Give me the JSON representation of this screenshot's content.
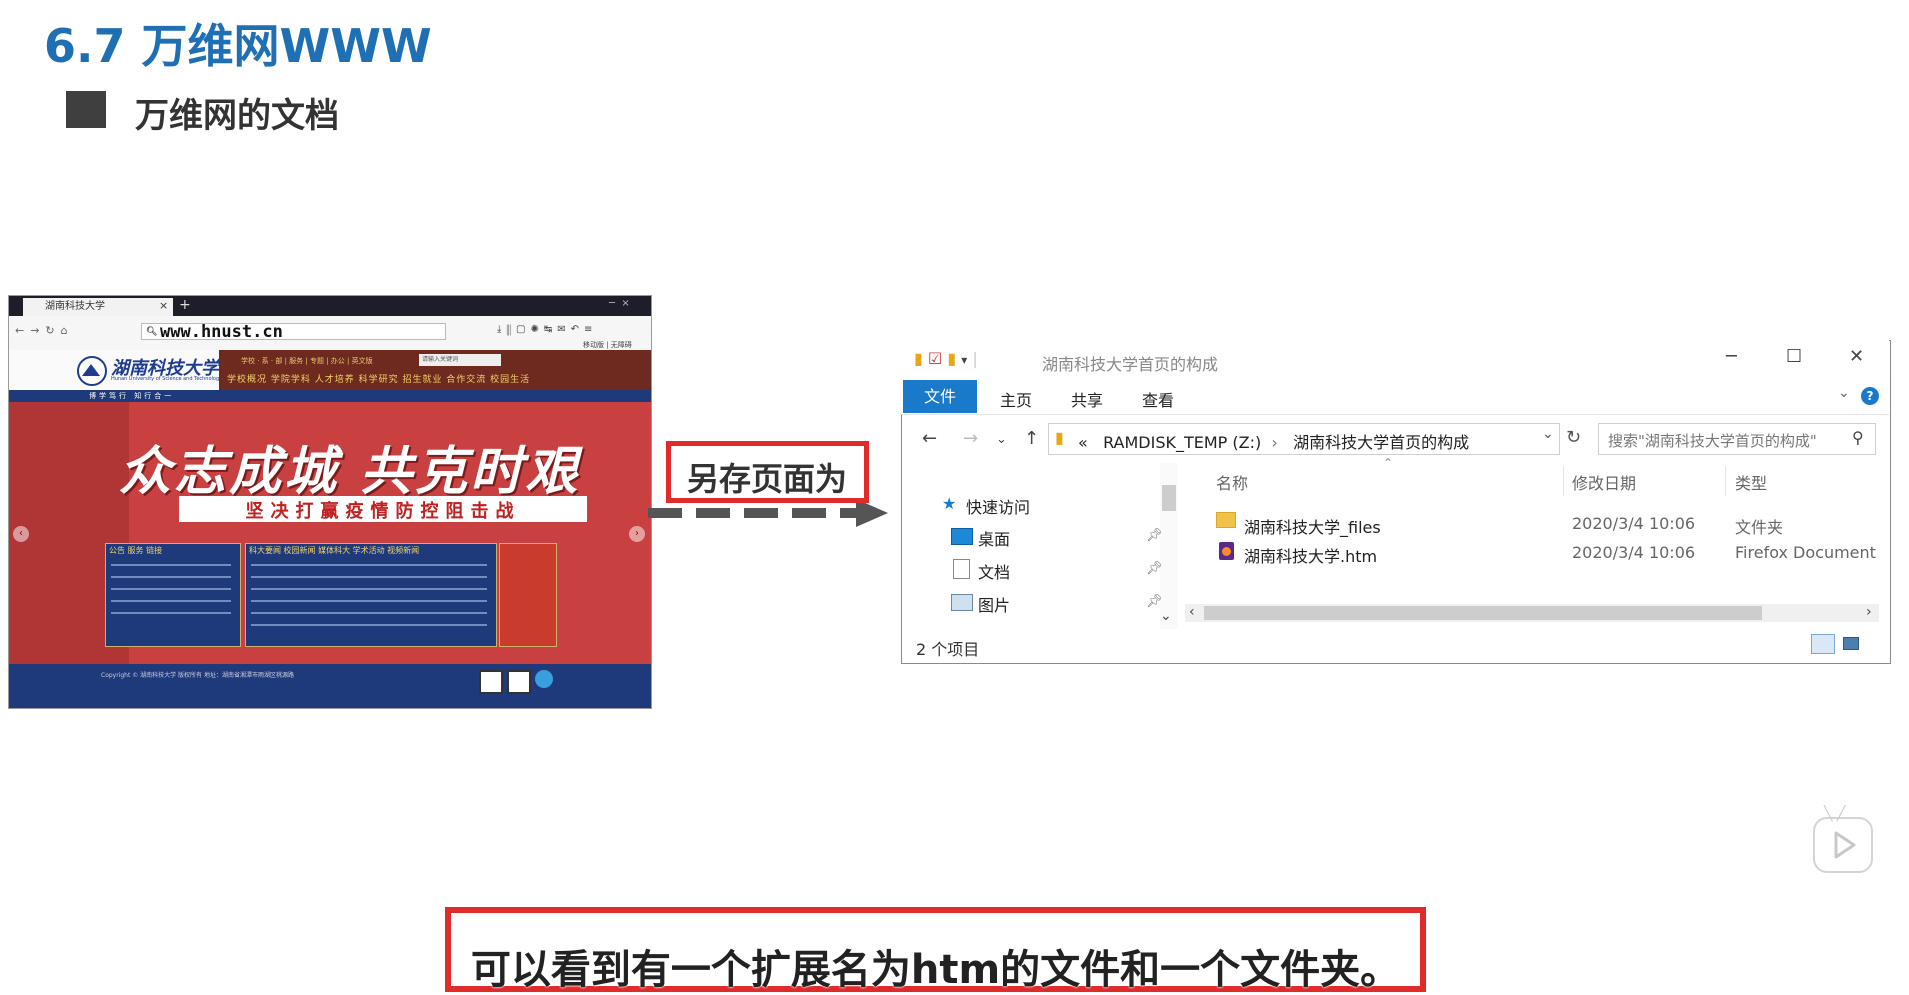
{
  "slide": {
    "title": "6.7 万维网WWW",
    "subtitle": "万维网的文档"
  },
  "browser": {
    "tab_title": "湖南科技大学",
    "tab_close": "×",
    "new_tab": "+",
    "url": "www.hnust.cn",
    "mobile_link": "移动版 | 无障碍",
    "logo_text": "湖南科技大学",
    "logo_sub": "Hunan University of Science and Technology",
    "top_links": "学校 · 系 · 部 | 服务 | 专题 | 办公 | 英文版",
    "search_placeholder": "请输入关键词",
    "main_nav": "学校概况  学院学科  人才培养  科学研究  招生就业  合作交流  校园生活",
    "motto": "博学笃行  知行合一",
    "hero_text": "众志成城 共克时艰",
    "slogan": "坚决打赢疫情防控阻击战",
    "panel1_tabs": "公告  服务  链接",
    "panel2_tabs": "科大要闻  校园新闻  媒体科大  学术活动  视频新闻",
    "footer_text": "Copyright © 湖南科技大学 版权所有 地址：湖南省湘潭市雨湖区桃源路"
  },
  "arrow_label": "另存页面为",
  "explorer": {
    "title": "湖南科技大学首页的构成",
    "ribbon_tabs": [
      "文件",
      "主页",
      "共享",
      "查看"
    ],
    "address": [
      "RAMDISK_TEMP (Z:)",
      "湖南科技大学首页的构成"
    ],
    "address_prefix": "«",
    "search_placeholder": "搜索\"湖南科技大学首页的构成\"",
    "nav_items": [
      {
        "label": "快速访问",
        "icon": "star-icon"
      },
      {
        "label": "桌面",
        "icon": "desktop-icon"
      },
      {
        "label": "文档",
        "icon": "document-icon"
      },
      {
        "label": "图片",
        "icon": "picture-icon"
      }
    ],
    "columns": [
      "名称",
      "修改日期",
      "类型"
    ],
    "files": [
      {
        "name": "湖南科技大学_files",
        "date": "2020/3/4 10:06",
        "type": "文件夹",
        "icon": "folder-icon"
      },
      {
        "name": "湖南科技大学.htm",
        "date": "2020/3/4 10:06",
        "type": "Firefox Document",
        "icon": "firefox-doc-icon"
      }
    ],
    "status": "2 个项目"
  },
  "caption": "可以看到有一个扩展名为htm的文件和一个文件夹。",
  "colors": {
    "title_blue": "#1f6fb5",
    "highlight_red": "#e02b2b",
    "explorer_blue": "#1979ca",
    "hero_red": "#c8403f",
    "navy": "#1f3a7a"
  }
}
